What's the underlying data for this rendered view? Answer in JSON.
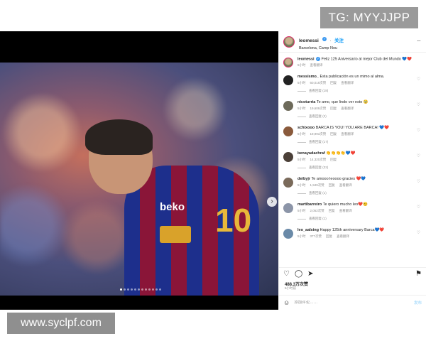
{
  "watermarks": {
    "top": "TG: MYYJJPP",
    "bottom": "www.syclpf.com"
  },
  "photo": {
    "shirt_sponsor": "beko",
    "shirt_number": "10",
    "carousel_dots": 12,
    "active_dot": 0
  },
  "header": {
    "username": "leomessi",
    "follow": "关注",
    "location": "Barcelona, Camp Nou",
    "more": "···"
  },
  "caption": {
    "username": "leomessi",
    "text": "Feliz 125 Aniversario al mejor Club del Mundo 💙❤️",
    "time": "5小时",
    "translate": "查看翻译"
  },
  "comments": [
    {
      "username": "messismo_",
      "text": "Esta publicación es un mimo al alma.",
      "time": "5小时",
      "likes": "60,019次赞",
      "reply": "回复",
      "translate": "查看翻译",
      "replies": "查看回复 (18)",
      "avatar_color": "#222222"
    },
    {
      "username": "nicoturria",
      "text": "Te amo, que lindo ver esto 🥹",
      "time": "5小时",
      "likes": "19,609次赞",
      "reply": "回复",
      "translate": "查看翻译",
      "replies": "查看回复 (2)",
      "avatar_color": "#6d6a5a"
    },
    {
      "username": "schixooo",
      "text": "BARCA IS YOU! YOU ARE BARCA! 💙❤️",
      "time": "5小时",
      "likes": "19,993次赞",
      "reply": "回复",
      "translate": "查看翻译",
      "replies": "查看回复 (17)",
      "avatar_color": "#8a5a3c"
    },
    {
      "username": "benayadachraf",
      "text": "👏👏👏👏💙❤️",
      "time": "5小时",
      "likes": "14,320次赞",
      "reply": "回复",
      "translate": "",
      "replies": "查看回复 (32)",
      "avatar_color": "#4b4038"
    },
    {
      "username": "deibyjr",
      "text": "Te amooo leoooo gracies ❤️💙",
      "time": "5小时",
      "likes": "1,949次赞",
      "reply": "回复",
      "translate": "查看翻译",
      "replies": "查看回复 (1)",
      "avatar_color": "#7a6a5a"
    },
    {
      "username": "martibarreiro",
      "text": "Te quiero mucho leo❤️😊",
      "time": "5小时",
      "likes": "2,052次赞",
      "reply": "回复",
      "translate": "查看翻译",
      "replies": "查看回复 (1)",
      "avatar_color": "#8c95a8"
    },
    {
      "username": "leo_aalsing",
      "text": "Happy 125th anniversary Barca💙❤️",
      "time": "5小时",
      "likes": "377次赞",
      "reply": "回复",
      "translate": "查看翻译",
      "replies": "",
      "avatar_color": "#6a8aa8"
    }
  ],
  "actions": {
    "like": "♡",
    "comment": "◯",
    "share": "➤",
    "save": "⚑"
  },
  "likes_count": "488.3万次赞",
  "post_time": "5小时前",
  "add_comment": {
    "emoji": "☺",
    "placeholder": "添加评论……",
    "post": "发布"
  },
  "colors": {
    "accent": "#0095f6",
    "verified": "#3897f0",
    "story_ring": "#e1306c"
  }
}
